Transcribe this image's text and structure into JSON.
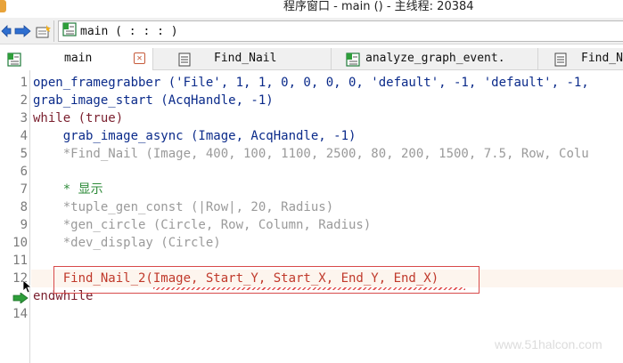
{
  "window": {
    "title": "程序窗口 - main () - 主线程: 20384"
  },
  "toolbar": {
    "back_icon": "back-arrow-icon",
    "forward_icon": "forward-arrow-icon",
    "insert_icon": "insert-procedure-icon",
    "procedure_label": "main ( : : : )"
  },
  "tabs": [
    {
      "label": "main",
      "icon": "procedure-icon",
      "active": true
    },
    {
      "label": "Find_Nail",
      "icon": "document-icon",
      "active": false
    },
    {
      "label": "analyze_graph_event.",
      "icon": "procedure-icon",
      "active": false
    },
    {
      "label": "Find_N",
      "icon": "document-icon",
      "active": false
    }
  ],
  "editor": {
    "line_numbers": [
      "1",
      "2",
      "3",
      "4",
      "5",
      "6",
      "7",
      "8",
      "9",
      "10",
      "11",
      "12",
      "13",
      "14"
    ],
    "lines": [
      "open_framegrabber ('File', 1, 1, 0, 0, 0, 0, 'default', -1, 'default', -1,",
      "grab_image_start (AcqHandle, -1)",
      "while (true)",
      "    grab_image_async (Image, AcqHandle, -1)",
      "    *Find_Nail (Image, 400, 100, 1100, 2500, 80, 200, 1500, 7.5, Row, Colu",
      "",
      "    * 显示",
      "    *tuple_gen_const (|Row|, 20, Radius)",
      "    *gen_circle (Circle, Row, Column, Radius)",
      "    *dev_display (Circle)",
      "",
      "    Find_Nail_2(Image, Start_Y, Start_X, End_Y, End_X)",
      "endwhile",
      ""
    ],
    "error_line": "12",
    "program_counter_line": "13"
  },
  "watermark": "www.51halcon.com",
  "colors": {
    "operator": "#0a2a8a",
    "keyword": "#7a1f2e",
    "comment": "#9a9a9a",
    "green_comment": "#2e8b3a",
    "error": "#c0392b",
    "pc_arrow": "#2e9e3a"
  }
}
